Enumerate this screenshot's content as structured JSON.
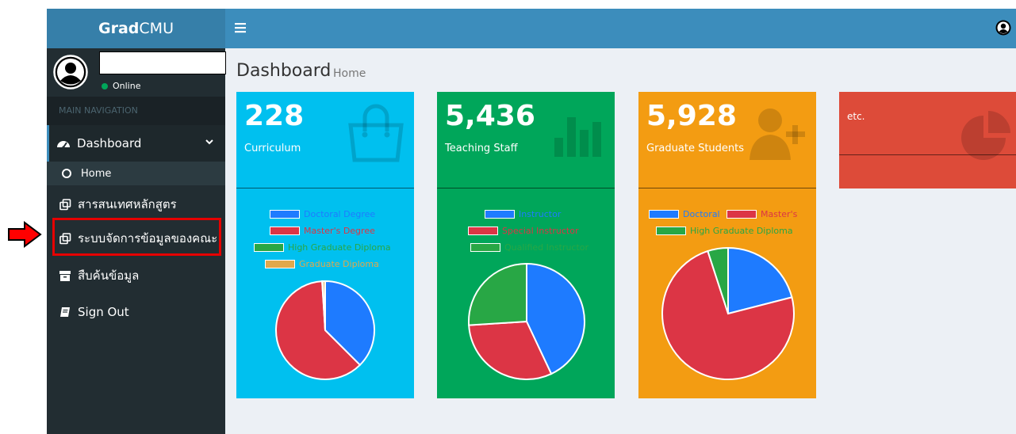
{
  "logo": {
    "bold": "Grad",
    "rest": "CMU"
  },
  "user": {
    "status": "Online"
  },
  "sidebar": {
    "header": "MAIN NAVIGATION",
    "dashboard": "Dashboard",
    "home": "Home",
    "items": [
      {
        "label": "สารสนเทศหลักสูตร",
        "icon": "clone-icon"
      },
      {
        "label": "ระบบจัดการข้อมูลของคณะ",
        "icon": "clone-icon"
      },
      {
        "label": "สืบค้นข้อมูล",
        "icon": "archive-icon"
      },
      {
        "label": "Sign Out",
        "icon": "book-icon"
      }
    ]
  },
  "page": {
    "title": "Dashboard",
    "subtitle": "Home"
  },
  "boxes": [
    {
      "value": "228",
      "label": "Curriculum",
      "icon": "shopping-bag-icon",
      "color": "#00c0ef"
    },
    {
      "value": "5,436",
      "label": "Teaching Staff",
      "icon": "bar-chart-icon",
      "color": "#00a65a"
    },
    {
      "value": "5,928",
      "label": "Graduate Students",
      "icon": "user-plus-icon",
      "color": "#f39c12"
    },
    {
      "value": "",
      "label": "etc.",
      "icon": "pie-chart-icon",
      "color": "#dd4b39"
    }
  ],
  "chart_data": [
    {
      "type": "pie",
      "legend": [
        "Doctoral Degree",
        "Master's Degree",
        "High Graduate Diploma",
        "Graduate Diploma"
      ],
      "colors": [
        "#1e7bff",
        "#dc3545",
        "#28a745",
        "#e0a84c"
      ],
      "values": [
        37.5,
        61.5,
        0.2,
        0.8
      ]
    },
    {
      "type": "pie",
      "legend": [
        "Instructor",
        "Special Instructor",
        "Qualified Instructor"
      ],
      "colors": [
        "#1e7bff",
        "#dc3545",
        "#28a745"
      ],
      "values": [
        43,
        31,
        26
      ]
    },
    {
      "type": "pie",
      "legend": [
        "Doctoral",
        "Master's",
        "High Graduate Diploma"
      ],
      "colors": [
        "#1e7bff",
        "#dc3545",
        "#28a745"
      ],
      "values": [
        21,
        74,
        5
      ]
    }
  ]
}
